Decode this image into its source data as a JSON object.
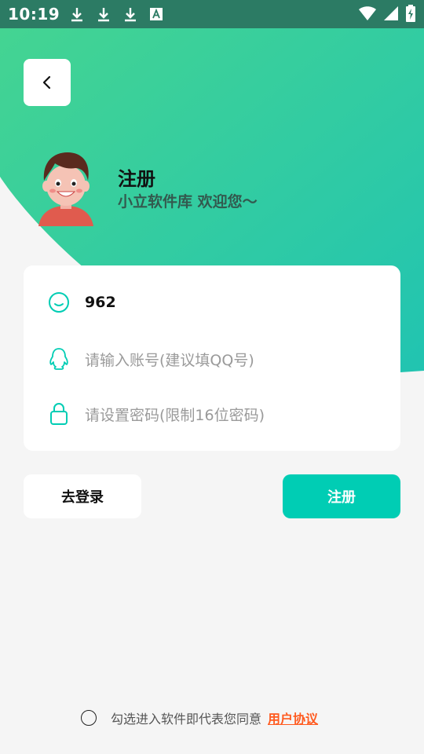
{
  "status_bar": {
    "time": "10:19"
  },
  "header": {
    "title": "注册",
    "subtitle": "小立软件库 欢迎您～"
  },
  "form": {
    "username_value": "962",
    "account_placeholder": "请输入账号(建议填QQ号)",
    "password_placeholder": "请设置密码(限制16位密码)"
  },
  "actions": {
    "login_label": "去登录",
    "register_label": "注册"
  },
  "agreement": {
    "text": "勾选进入软件即代表您同意",
    "link_label": "用户协议"
  },
  "colors": {
    "accent": "#00cdb4",
    "gradient_start": "#44d492",
    "gradient_end": "#21c4b1",
    "link": "#ff5a1f"
  }
}
